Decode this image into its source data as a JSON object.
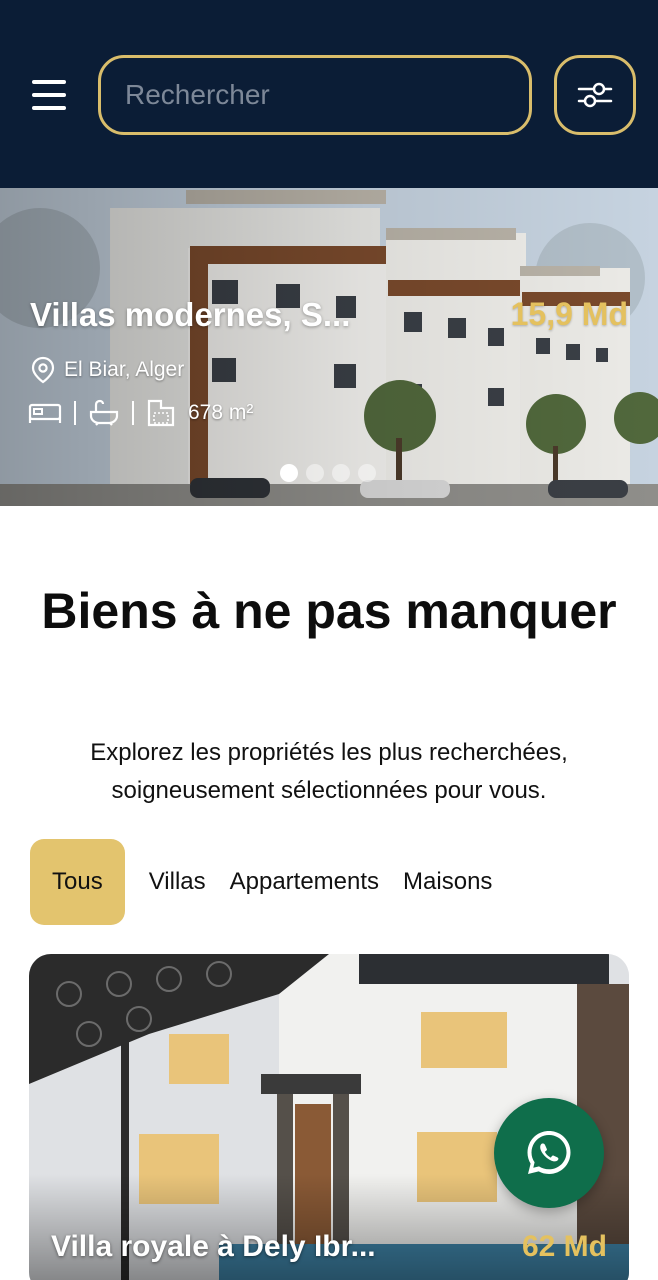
{
  "header": {
    "search_placeholder": "Rechercher",
    "colors": {
      "background": "#0b1d36",
      "accent": "#d9bd6b"
    }
  },
  "hero": {
    "title": "Villas modernes, S...",
    "price": "15,9 Md",
    "location": "El Biar, Alger",
    "area": "678 m²",
    "slides": 4,
    "active_slide": 1
  },
  "section": {
    "title": "Biens à ne pas manquer",
    "subtitle": "Explorez les propriétés les plus recherchées, soigneusement sélectionnées pour vous."
  },
  "tabs": [
    {
      "label": "Tous",
      "active": true
    },
    {
      "label": "Villas",
      "active": false
    },
    {
      "label": "Appartements",
      "active": false
    },
    {
      "label": "Maisons",
      "active": false
    }
  ],
  "card": {
    "title": "Villa royale à Dely Ibr...",
    "price": "62 Md"
  },
  "icons": {
    "menu": "menu-icon",
    "filter": "sliders-icon",
    "location": "map-pin-icon",
    "bed": "bed-icon",
    "bath": "bath-icon",
    "area": "area-icon",
    "whatsapp": "whatsapp-icon"
  }
}
